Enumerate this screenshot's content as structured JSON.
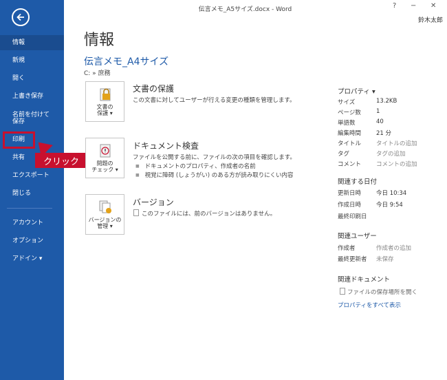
{
  "window": {
    "title": "伝言メモ_A5サイズ.docx - Word",
    "help": "?",
    "minimize": "−",
    "close": "✕",
    "user": "鈴木太郎"
  },
  "sidebar": {
    "items": [
      {
        "label": "情報"
      },
      {
        "label": "新規"
      },
      {
        "label": "開く"
      },
      {
        "label": "上書き保存"
      },
      {
        "label": "名前を付けて保存"
      },
      {
        "label": "印刷"
      },
      {
        "label": "共有"
      },
      {
        "label": "エクスポート"
      },
      {
        "label": "閉じる"
      },
      {
        "label": "アカウント"
      },
      {
        "label": "オプション"
      },
      {
        "label": "アドイン ▾"
      }
    ]
  },
  "callout": {
    "label": "クリック"
  },
  "main": {
    "title": "情報",
    "doc_name": "伝言メモ_A4サイズ",
    "doc_path": "C: » 庶務",
    "protect": {
      "button": "文書の\n保護 ▾",
      "title": "文書の保護",
      "desc": "この文書に対してユーザーが行える変更の種類を管理します。"
    },
    "inspect": {
      "button": "問題の\nチェック ▾",
      "title": "ドキュメント検査",
      "desc": "ファイルを公開する前に、ファイルの次の項目を確認します。",
      "bullets": [
        "ドキュメントのプロパティ、作成者の名前",
        "視覚に障碍 (しょうがい) のある方が読み取りにくい内容"
      ]
    },
    "version": {
      "button": "バージョンの\n管理 ▾",
      "title": "バージョン",
      "desc": "このファイルには、前のバージョンはありません。"
    }
  },
  "properties": {
    "heading": "プロパティ ▾",
    "rows": [
      {
        "label": "サイズ",
        "value": "13.2KB"
      },
      {
        "label": "ページ数",
        "value": "1"
      },
      {
        "label": "単語数",
        "value": "40"
      },
      {
        "label": "編集時間",
        "value": "21 分"
      },
      {
        "label": "タイトル",
        "value": "タイトルの追加"
      },
      {
        "label": "タグ",
        "value": "タグの追加"
      },
      {
        "label": "コメント",
        "value": "コメントの追加"
      }
    ],
    "dates_heading": "関連する日付",
    "dates": [
      {
        "label": "更新日時",
        "value": "今日 10:34"
      },
      {
        "label": "作成日時",
        "value": "今日 9:54"
      },
      {
        "label": "最終印刷日",
        "value": ""
      }
    ],
    "users_heading": "関連ユーザー",
    "users": [
      {
        "label": "作成者",
        "value": "作成者の追加"
      },
      {
        "label": "最終更新者",
        "value": "未保存"
      }
    ],
    "docs_heading": "関連ドキュメント",
    "open_location": "ファイルの保存場所を開く",
    "show_all": "プロパティをすべて表示"
  }
}
